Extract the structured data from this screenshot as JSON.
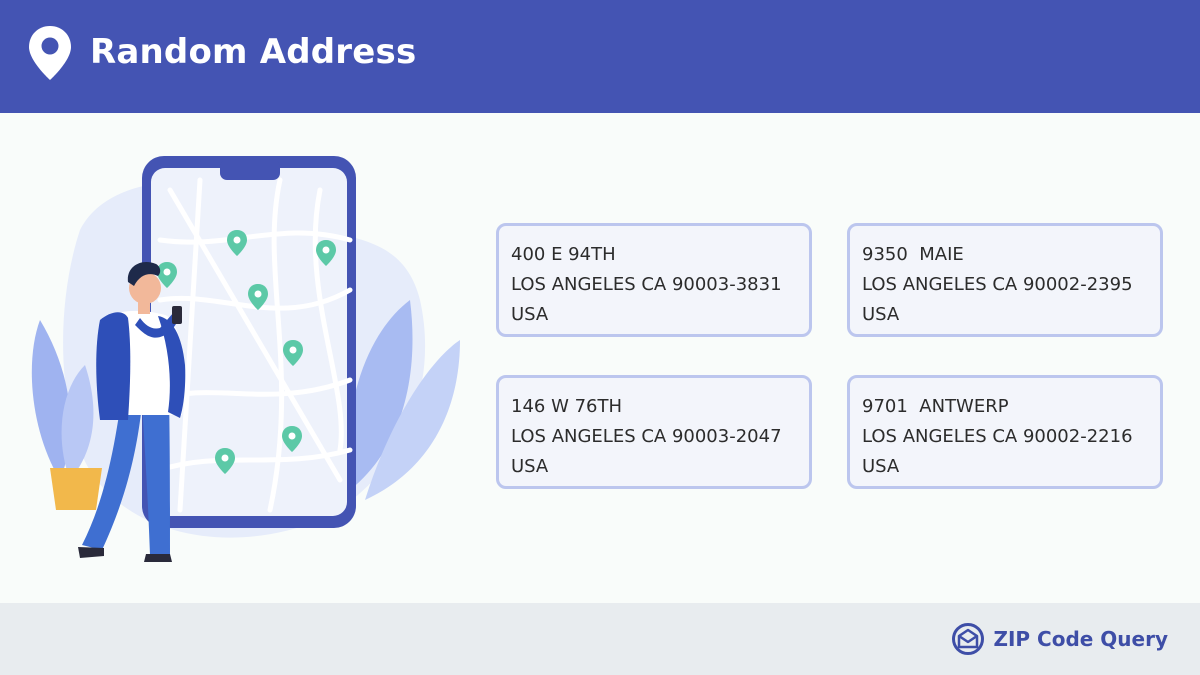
{
  "header": {
    "title": "Random Address",
    "icon": "location-pin-icon"
  },
  "addresses": [
    {
      "line1": "400 E 94TH",
      "line2": "LOS ANGELES CA 90003-3831",
      "line3": "USA"
    },
    {
      "line1": "9350  MAIE",
      "line2": "LOS ANGELES CA 90002-2395",
      "line3": "USA"
    },
    {
      "line1": "146 W 76TH",
      "line2": "LOS ANGELES CA 90003-2047",
      "line3": "USA"
    },
    {
      "line1": "9701  ANTWERP",
      "line2": "LOS ANGELES CA 90002-2216",
      "line3": "USA"
    }
  ],
  "footer": {
    "brand_label": "ZIP Code Query",
    "icon": "mail-check-icon"
  },
  "colors": {
    "header_bg": "#4454b3",
    "card_border": "#bcc6ee",
    "card_bg": "#f3f5fb",
    "footer_bg": "#e8ecef",
    "brand": "#3e4ea7"
  }
}
